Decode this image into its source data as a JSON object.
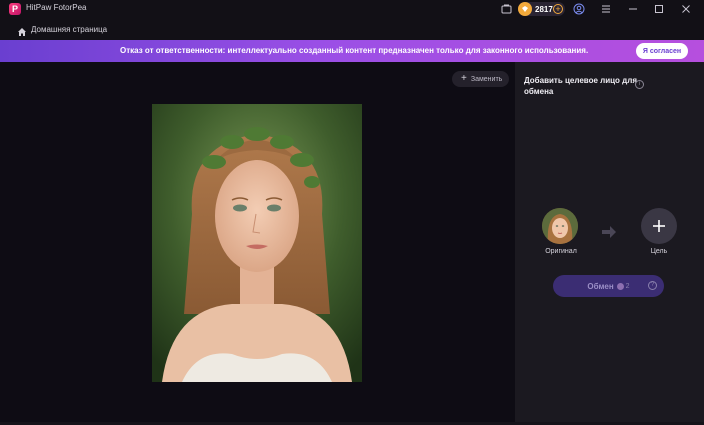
{
  "app": {
    "title": "HitPaw FotorPea",
    "logo_letter": "P"
  },
  "titlebar": {
    "coins": "2817",
    "icons": [
      "gallery-icon",
      "coin-icon",
      "add-coins-icon",
      "account-icon",
      "menu-icon",
      "minimize-icon",
      "maximize-icon",
      "close-icon"
    ]
  },
  "nav": {
    "home_label": "Домашняя страница"
  },
  "banner": {
    "text": "Отказ от ответственности: интеллектуально созданный контент предназначен только для законного использования.",
    "agree_label": "Я согласен"
  },
  "canvas": {
    "replace_label": "Заменить"
  },
  "panel": {
    "title": "Добавить целевое лицо для обмена",
    "info": "i",
    "original_label": "Оригинал",
    "target_label": "Цель",
    "swap_label": "Обмен",
    "swap_cost": "2",
    "help": "?"
  },
  "colors": {
    "accent": "#6a3fd0",
    "banner_end": "#b64fde",
    "panel_bg": "#1b1920",
    "canvas_bg": "#0e0c14",
    "swap_button": "#3b2d73",
    "coin": "#f2a93b"
  }
}
